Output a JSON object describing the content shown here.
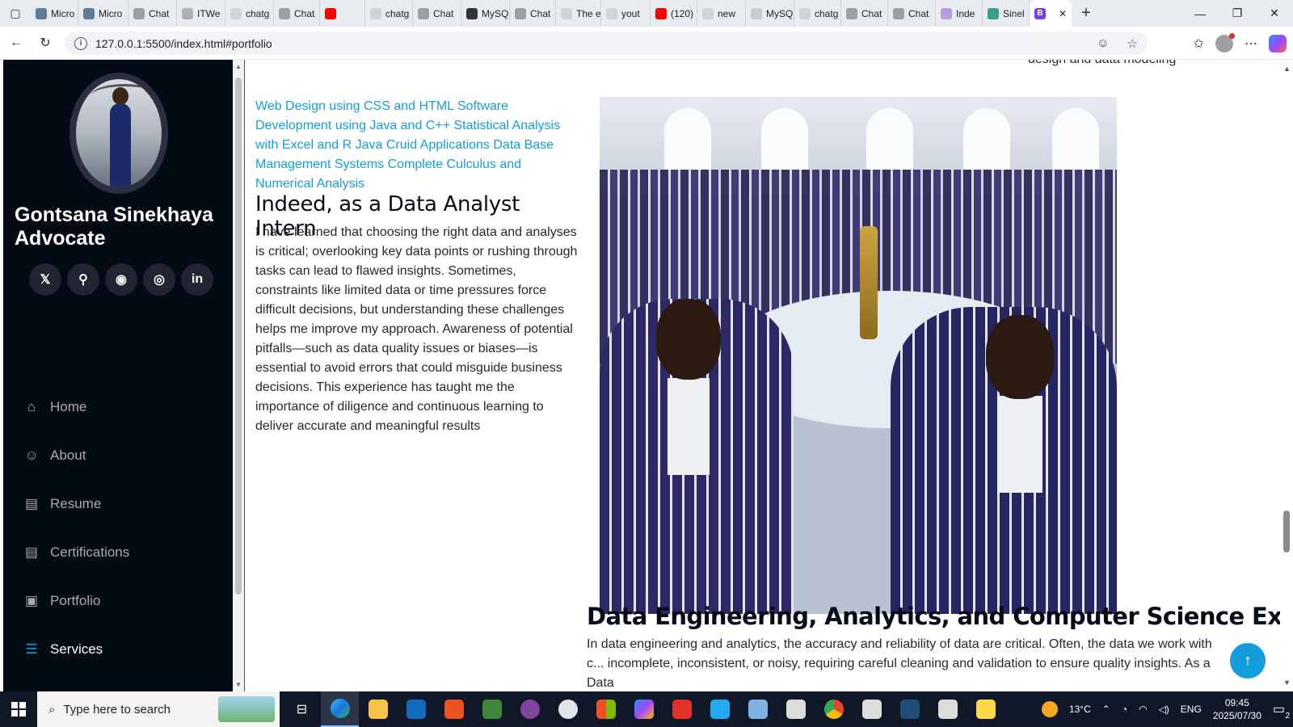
{
  "browser": {
    "tabs": [
      {
        "label": "Micro",
        "color": "#5f7e96"
      },
      {
        "label": "Micro",
        "color": "#5f7e96"
      },
      {
        "label": "Chat",
        "color": "#9aa0a6"
      },
      {
        "label": "ITWe",
        "color": "#b0b0b0"
      },
      {
        "label": "chatg",
        "color": "#d0d4da"
      },
      {
        "label": "Chat",
        "color": "#9aa0a6"
      },
      {
        "label": "",
        "color": "#ff0000"
      },
      {
        "label": "chatg",
        "color": "#d0d4da"
      },
      {
        "label": "Chat",
        "color": "#9aa0a6"
      },
      {
        "label": "MySQ",
        "color": "#333333"
      },
      {
        "label": "Chat",
        "color": "#9aa0a6"
      },
      {
        "label": "The e",
        "color": "#d0d4da"
      },
      {
        "label": "yout",
        "color": "#d0d4da"
      },
      {
        "label": "(120)",
        "color": "#ff0000"
      },
      {
        "label": "new",
        "color": "#d0d4da"
      },
      {
        "label": "MySQ",
        "color": "#c8ccd2"
      },
      {
        "label": "chatg",
        "color": "#d0d4da"
      },
      {
        "label": "Chat",
        "color": "#9aa0a6"
      },
      {
        "label": "Chat",
        "color": "#9aa0a6"
      },
      {
        "label": "Inde",
        "color": "#b79ce0"
      },
      {
        "label": "Sinel",
        "color": "#3e9c8c"
      }
    ],
    "active_tab_letter": "B",
    "url": "127.0.0.1:5500/index.html#portfolio"
  },
  "sidebar": {
    "name": "Gontsana Sinekhaya Advocate",
    "socials": [
      {
        "icon": "x-icon",
        "glyph": "𝕏"
      },
      {
        "icon": "skype-icon",
        "glyph": "⚲"
      },
      {
        "icon": "github-icon",
        "glyph": "◉"
      },
      {
        "icon": "instagram-icon",
        "glyph": "◎"
      },
      {
        "icon": "linkedin-icon",
        "glyph": "in"
      }
    ],
    "nav": [
      {
        "label": "Home",
        "icon": "home-icon",
        "glyph": "⌂",
        "active": false
      },
      {
        "label": "About",
        "icon": "person-icon",
        "glyph": "☺",
        "active": false
      },
      {
        "label": "Resume",
        "icon": "file-icon",
        "glyph": "▤",
        "active": false
      },
      {
        "label": "Certifications",
        "icon": "file-icon",
        "glyph": "▤",
        "active": false
      },
      {
        "label": "Portfolio",
        "icon": "image-icon",
        "glyph": "▣",
        "active": false
      },
      {
        "label": "Services",
        "icon": "server-icon",
        "glyph": "☰",
        "active": true
      }
    ],
    "accent": "#149ddd",
    "background": "#040b14"
  },
  "main": {
    "top_clip": "design and data modeling",
    "skills": "Web Design using CSS and HTML Software Development using Java and C++ Statistical Analysis with Excel and R Java Cruid Applications Data Base Management Systems Complete Culculus and Numerical Analysis",
    "intern_title": "Indeed, as a Data Analyst Intern",
    "intern_text": "I have learned that choosing the right data and analyses is critical; overlooking key data points or rushing through tasks can lead to flawed insights. Sometimes, constraints like limited data or time pressures force difficult decisions, but understanding these challenges helps me improve my approach. Awareness of potential pitfalls—such as data quality issues or biases—is essential to avoid errors that could misguide business decisions. This experience has taught me the importance of diligence and continuous learning to deliver accurate and meaningful results",
    "de_title": "Data Engineering, Analytics, and Computer Science Experience",
    "de_text": "In data engineering and analytics, the accuracy and reliability of data are critical. Often, the data we work with c... incomplete, inconsistent, or noisy, requiring careful cleaning and validation to ensure quality insights. As a Data"
  },
  "taskbar": {
    "search_placeholder": "Type here to search",
    "temperature": "13°C",
    "language": "ENG",
    "time": "09:45",
    "date": "2025/07/30",
    "notifications": "2"
  }
}
